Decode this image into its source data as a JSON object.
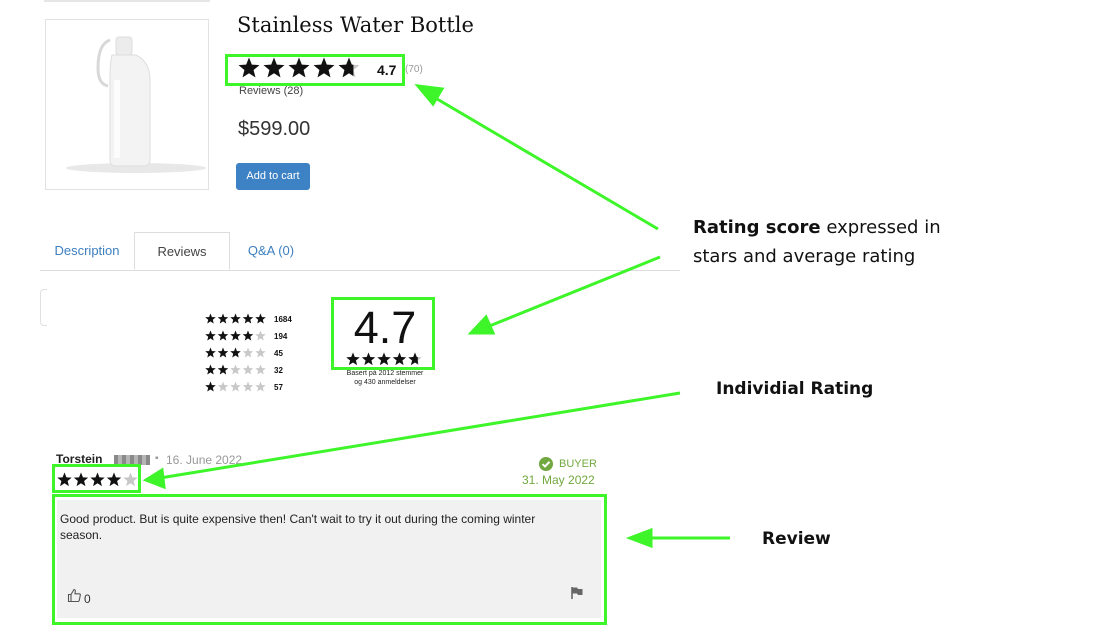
{
  "product": {
    "title": "Stainless Water Bottle",
    "rating_value": 4.7,
    "average_label": "4.7",
    "rating_count_label": "(70)",
    "reviews_link": "Reviews (28)",
    "price": "$599.00",
    "add_to_cart_label": "Add to cart"
  },
  "tabs": [
    {
      "label": "Description",
      "active": false
    },
    {
      "label": "Reviews",
      "active": true
    },
    {
      "label": "Q&A (0)",
      "active": false
    }
  ],
  "distribution": {
    "rows": [
      {
        "stars": 5,
        "count": "1684"
      },
      {
        "stars": 4,
        "count": "194"
      },
      {
        "stars": 3,
        "count": "45"
      },
      {
        "stars": 2,
        "count": "32"
      },
      {
        "stars": 1,
        "count": "57"
      }
    ],
    "average_big": "4.7",
    "average_value": 4.7,
    "basert_line1": "Basert på 2012 stemmer",
    "basert_line2": "og 430 anmeldelser"
  },
  "review": {
    "reviewer_name": "Torstein",
    "separator": "▪",
    "date": "16. June 2022",
    "stars": 4,
    "buyer_label": "BUYER",
    "buyer_date": "31. May 2022",
    "text": "Good product. But is quite expensive then! Can't wait to try it out during the coming winter season.",
    "likes": "0"
  },
  "annotations": {
    "rating_score_bold": "Rating score",
    "rating_score_rest": " expressed in",
    "rating_score_line2": "stars and average rating",
    "individual_rating": "Individial Rating",
    "review": "Review"
  },
  "colors": {
    "highlight": "#3ef52a",
    "link_blue": "#3d7fbf",
    "button_blue": "#3d82c4",
    "buyer_green": "#71a83f",
    "star_filled": "#111111",
    "star_empty": "#c8c8c8"
  }
}
